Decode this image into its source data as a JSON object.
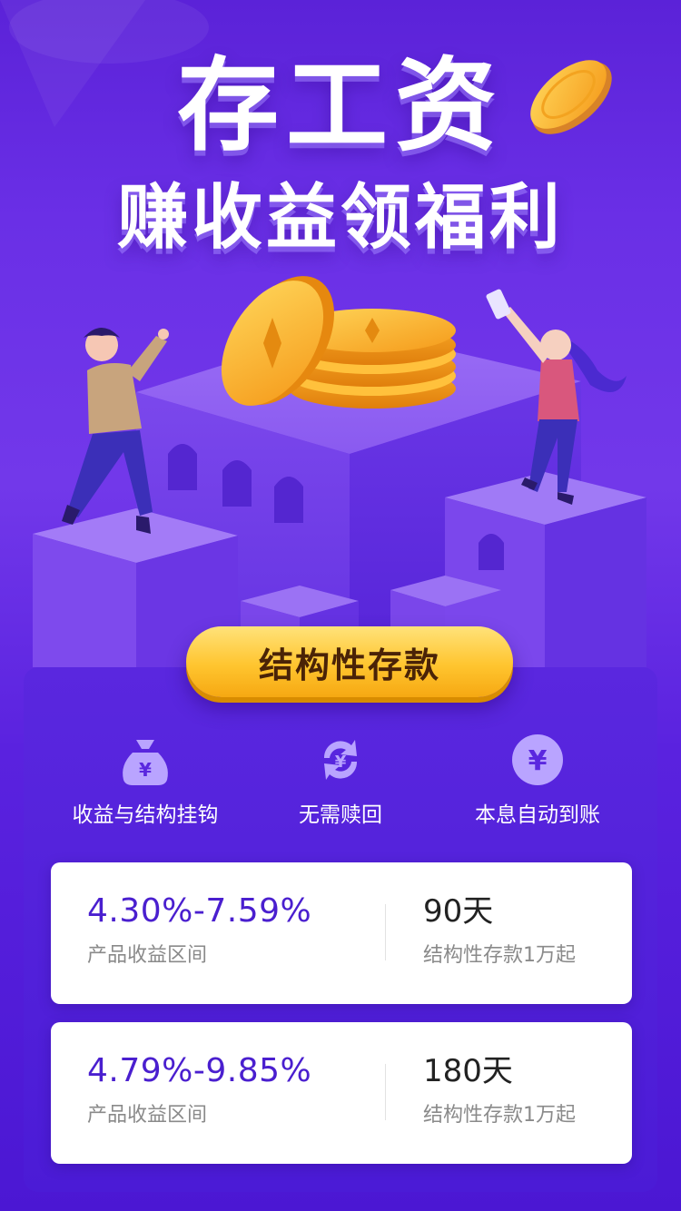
{
  "hero": {
    "line1": "存工资",
    "line2": "赚收益领福利"
  },
  "cta": {
    "label": "结构性存款"
  },
  "features": [
    {
      "label": "收益与结构挂钩",
      "icon": "money-bag-icon"
    },
    {
      "label": "无需赎回",
      "icon": "cycle-yen-icon"
    },
    {
      "label": "本息自动到账",
      "icon": "yen-coin-icon"
    }
  ],
  "products": [
    {
      "rate": "4.30%-7.59%",
      "rate_label": "产品收益区间",
      "term": "90天",
      "term_label": "结构性存款1万起"
    },
    {
      "rate": "4.79%-9.85%",
      "rate_label": "产品收益区间",
      "term": "180天",
      "term_label": "结构性存款1万起"
    }
  ],
  "colors": {
    "background": "#6a2fe6",
    "accent_gold": "#ffc52f",
    "rate_text": "#4a1fcf",
    "icon_fill": "#b9a4ff"
  }
}
